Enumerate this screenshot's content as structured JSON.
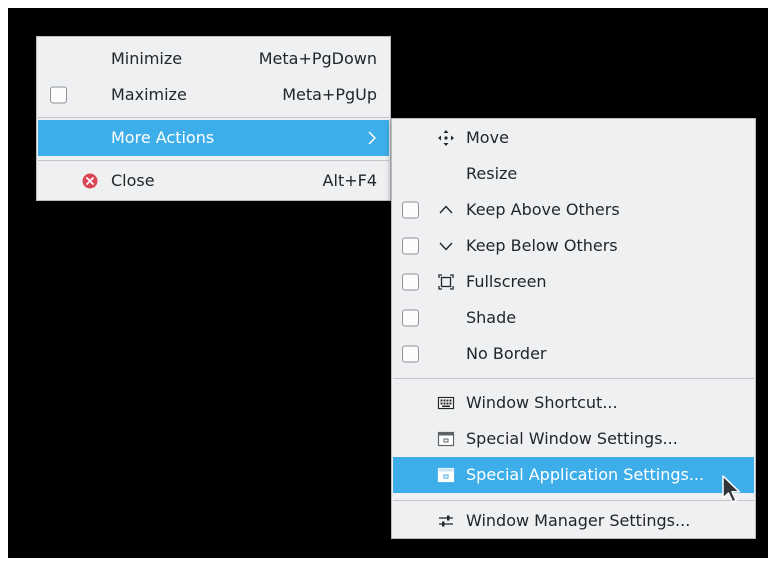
{
  "main_menu": {
    "items": [
      {
        "label": "Minimize",
        "shortcut": "Meta+PgDown"
      },
      {
        "label": "Maximize",
        "shortcut": "Meta+PgUp"
      },
      {
        "label": "More Actions"
      },
      {
        "label": "Close",
        "shortcut": "Alt+F4"
      }
    ]
  },
  "sub_menu": {
    "items": [
      {
        "label": "Move",
        "icon": "move-icon"
      },
      {
        "label": "Resize"
      },
      {
        "label": "Keep Above Others",
        "icon": "chevron-up-icon",
        "checked": false
      },
      {
        "label": "Keep Below Others",
        "icon": "chevron-down-icon",
        "checked": false
      },
      {
        "label": "Fullscreen",
        "icon": "fullscreen-icon",
        "checked": false
      },
      {
        "label": "Shade",
        "checked": false
      },
      {
        "label": "No Border",
        "checked": false
      },
      {
        "label": "Window Shortcut...",
        "icon": "keyboard-icon"
      },
      {
        "label": "Special Window Settings...",
        "icon": "window-settings-icon"
      },
      {
        "label": "Special Application Settings...",
        "icon": "application-settings-icon"
      },
      {
        "label": "Window Manager Settings...",
        "icon": "sliders-icon"
      }
    ]
  },
  "colors": {
    "highlight": "#3daee9",
    "menu_bg": "#eff0f1",
    "text": "#232629",
    "close_icon": "#da4453"
  }
}
